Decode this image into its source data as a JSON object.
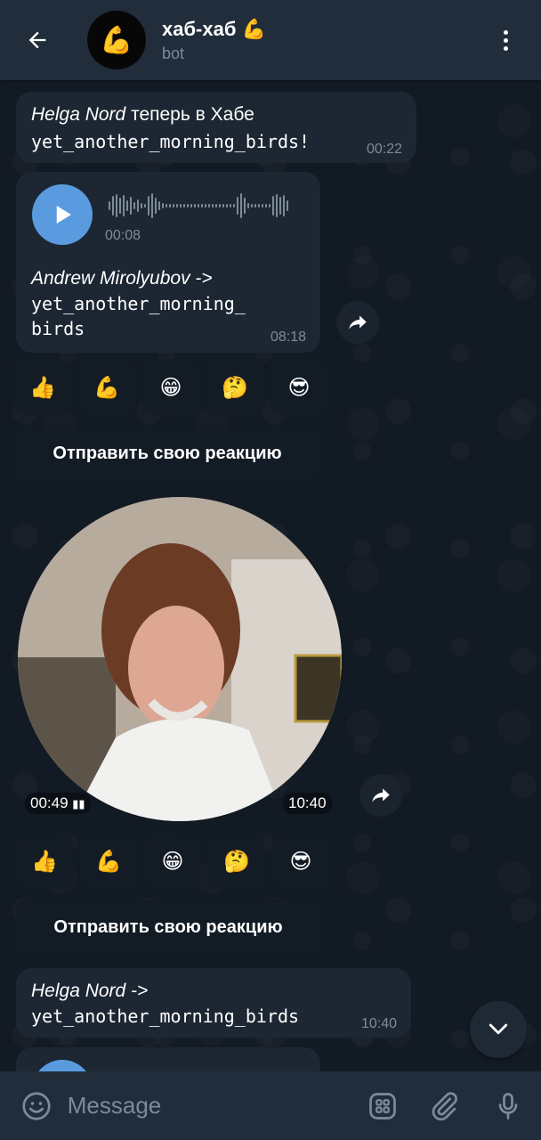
{
  "header": {
    "title": "хаб-хаб 💪",
    "subtitle": "bot",
    "avatar_emoji": "💪"
  },
  "messages": {
    "join_notice": {
      "author": "Helga Nord",
      "text": " теперь в Хабе",
      "chat": "yet_another_morning_birds!",
      "time": "00:22"
    },
    "voice": {
      "duration": "00:08",
      "author": "Andrew Mirolyubov ->",
      "chat_line1": "yet_another_morning_",
      "chat_line2": "birds",
      "time": "08:18"
    },
    "video": {
      "duration": "00:49",
      "time": "10:40"
    },
    "last": {
      "author": "Helga Nord ->",
      "chat": "yet_another_morning_birds",
      "time": "10:40"
    }
  },
  "reactions": {
    "buttons": [
      "👍",
      "💪",
      "😁",
      "🤔",
      "😎"
    ],
    "send_reaction_label": "Отправить свою реакцию"
  },
  "input": {
    "placeholder": "Message"
  },
  "colors": {
    "header_bg": "#212d3b",
    "bubble_bg": "#1d2733",
    "accent": "#5a9be0",
    "muted": "#7d8b99"
  },
  "icons": {
    "back": "arrow-left-icon",
    "menu": "more-vertical-icon",
    "play": "play-icon",
    "share": "share-icon",
    "scroll": "chevron-down-icon",
    "emoji": "emoji-icon",
    "bot_commands": "bot-commands-icon",
    "attach": "paperclip-icon",
    "mic": "microphone-icon"
  }
}
